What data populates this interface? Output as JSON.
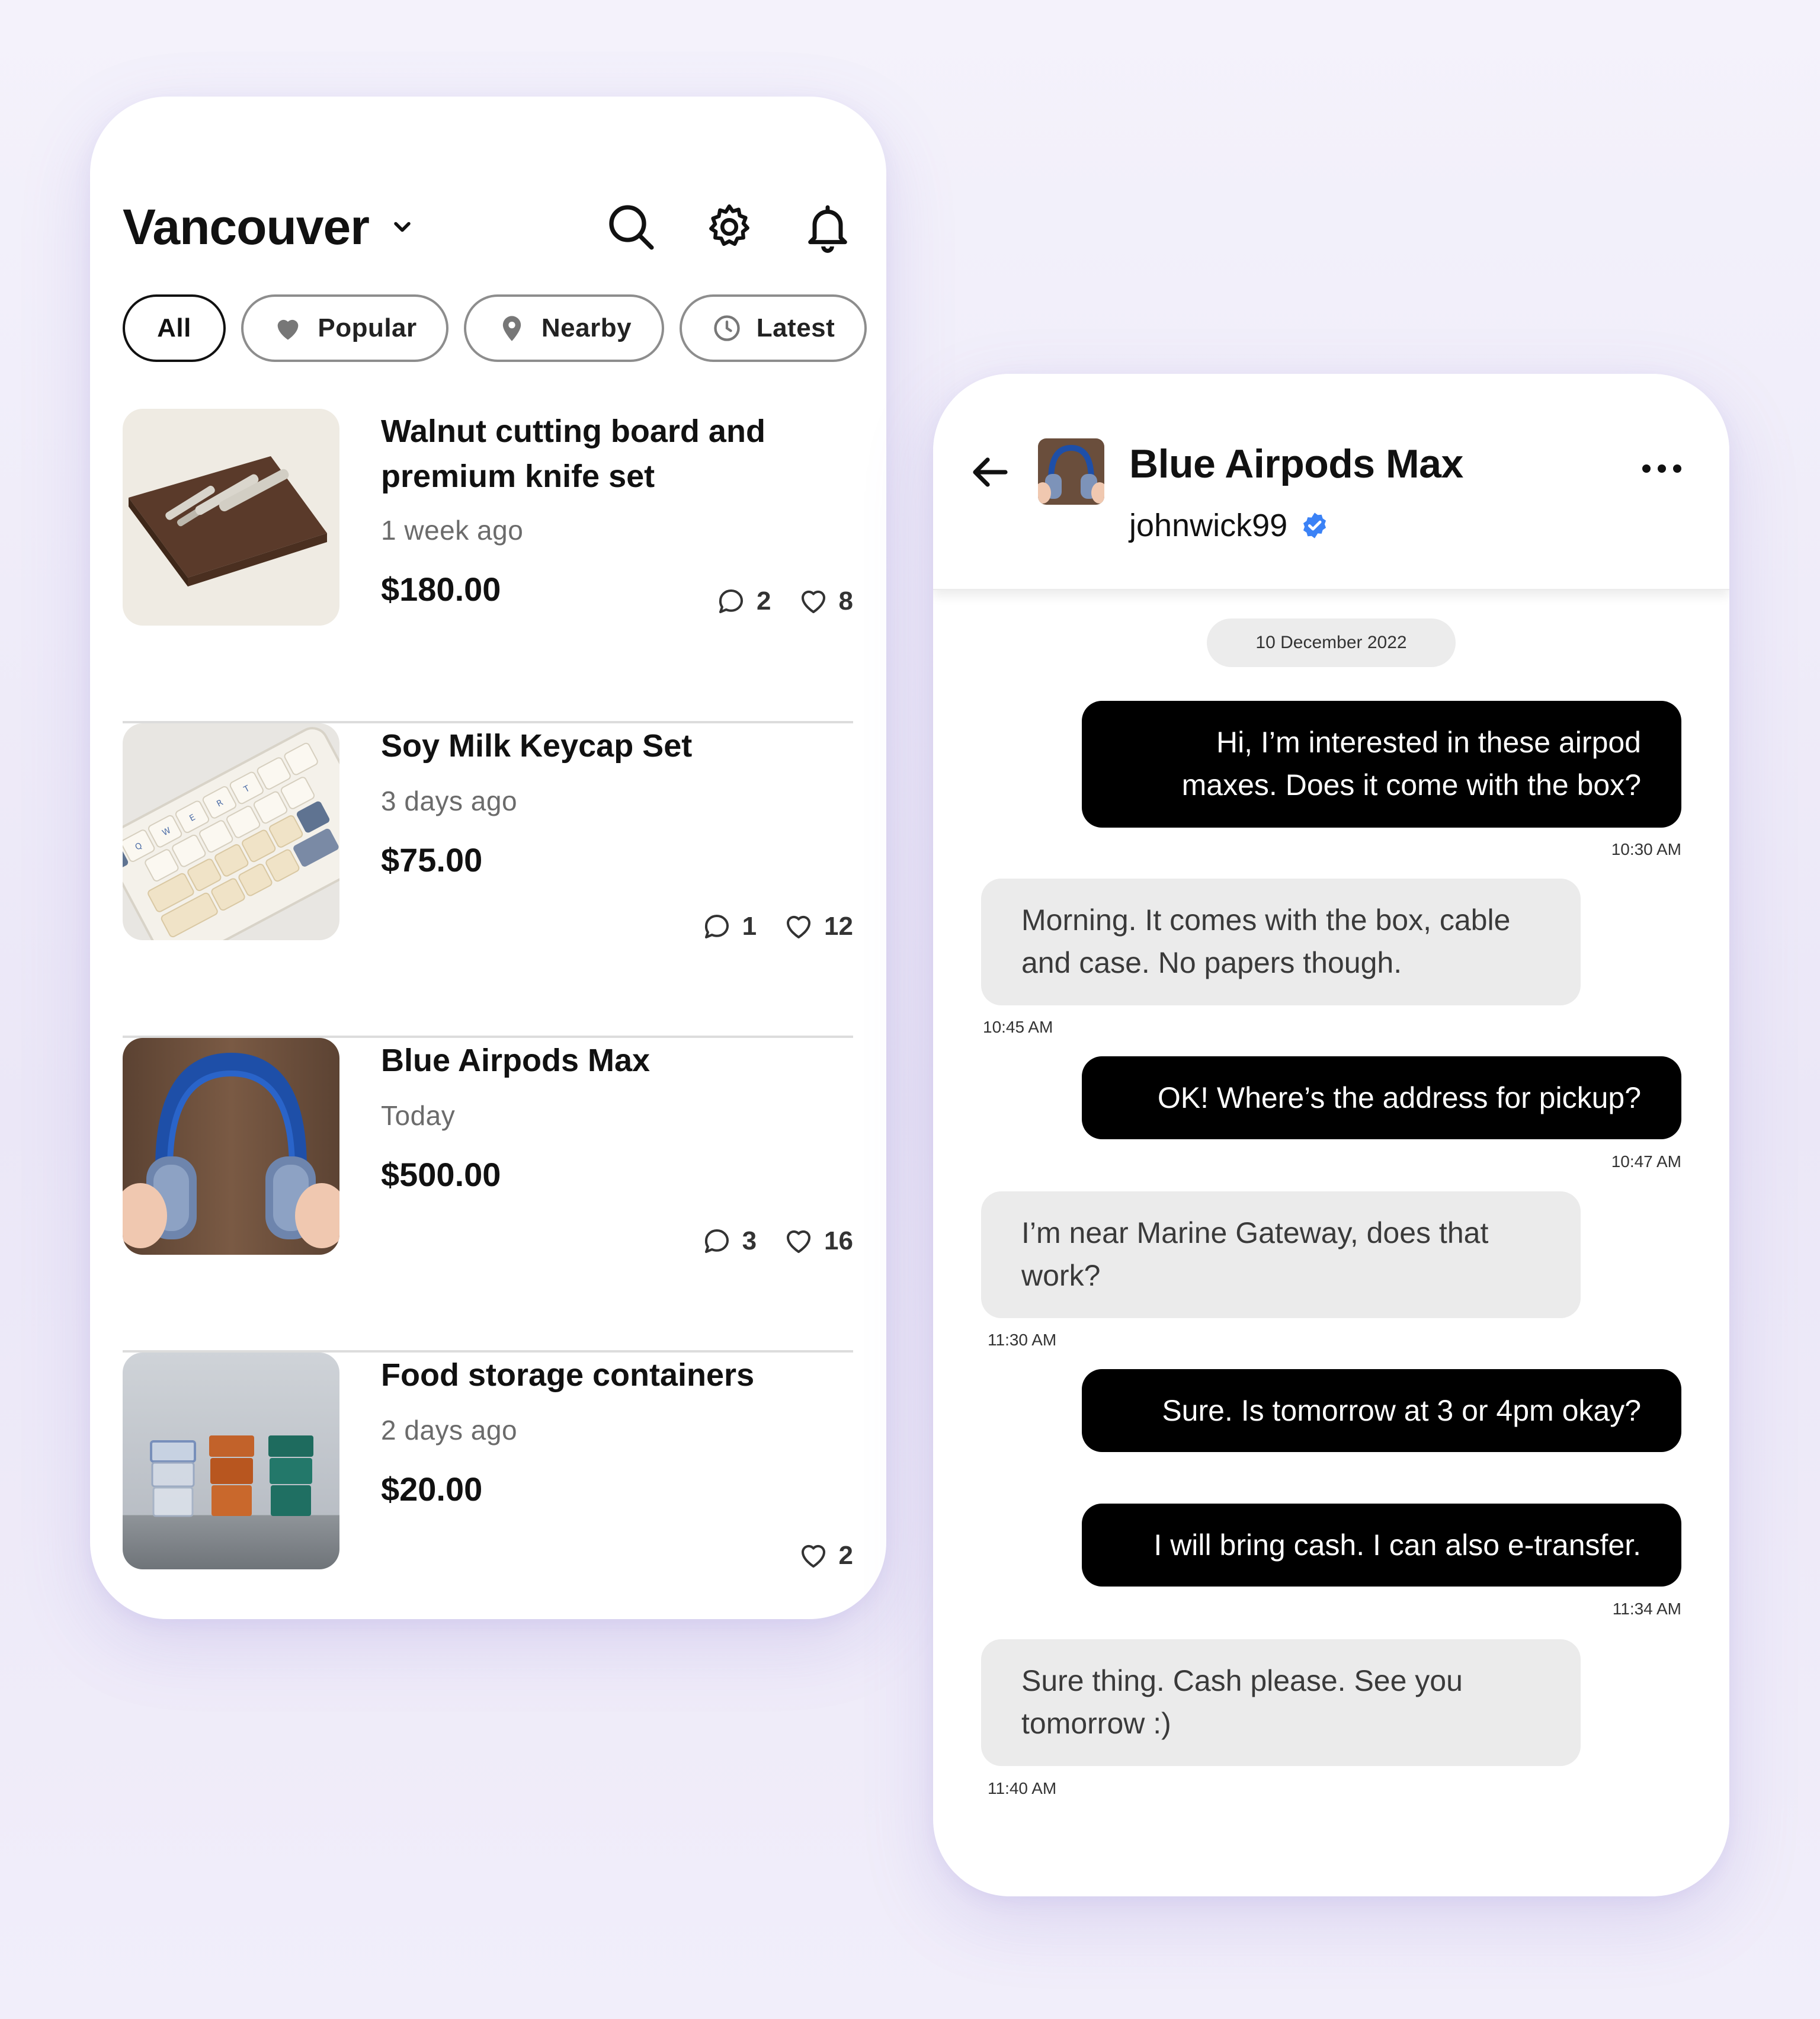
{
  "feed": {
    "city": "Vancouver",
    "filters": [
      {
        "label": "All",
        "icon": "none",
        "active": true
      },
      {
        "label": "Popular",
        "icon": "heart-icon",
        "active": false
      },
      {
        "label": "Nearby",
        "icon": "location-pin-icon",
        "active": false
      },
      {
        "label": "Latest",
        "icon": "clock-icon",
        "active": false
      }
    ],
    "listings": [
      {
        "title": "Walnut cutting board and premium knife set",
        "time": "1 week ago",
        "price": "$180.00",
        "comments": "2",
        "likes": "8"
      },
      {
        "title": "Soy Milk Keycap Set",
        "time": "3 days ago",
        "price": "$75.00",
        "comments": "1",
        "likes": "12"
      },
      {
        "title": "Blue Airpods Max",
        "time": "Today",
        "price": "$500.00",
        "comments": "3",
        "likes": "16"
      },
      {
        "title": "Food storage containers",
        "time": "2 days ago",
        "price": "$20.00",
        "comments": null,
        "likes": "2"
      }
    ]
  },
  "chat": {
    "title": "Blue Airpods Max",
    "username": "johnwick99",
    "verified": true,
    "date": "10 December 2022",
    "messages": [
      {
        "dir": "out",
        "text": "Hi, I’m interested in these airpod maxes. Does it come with the box?",
        "time": "10:30 AM"
      },
      {
        "dir": "in",
        "text": "Morning. It comes with the box, cable and case. No papers though.",
        "time": "10:45 AM"
      },
      {
        "dir": "out",
        "text": "OK! Where’s the address for pickup?",
        "time": "10:47 AM"
      },
      {
        "dir": "in",
        "text": "I’m near Marine Gateway, does that work?",
        "time": "11:30 AM"
      },
      {
        "dir": "out",
        "text": "Sure. Is tomorrow at 3 or 4pm okay?",
        "time": ""
      },
      {
        "dir": "out",
        "text": "I will bring cash. I can also e-transfer.",
        "time": "11:34 AM"
      },
      {
        "dir": "in",
        "text": "Sure thing. Cash please. See you tomorrow :)",
        "time": "11:40 AM"
      }
    ]
  },
  "colors": {
    "background": "#efecf9",
    "outgoing_bubble": "#000000",
    "incoming_bubble": "#ebebeb",
    "verified_badge": "#3b82f6"
  }
}
